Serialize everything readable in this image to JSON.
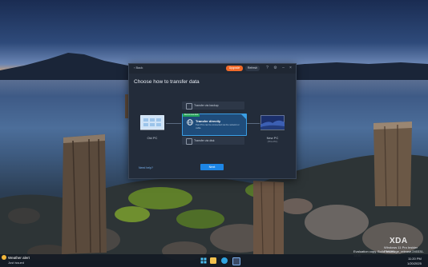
{
  "app": {
    "back_label": "Back",
    "upgrade_label": "Upgrade",
    "refresh_label": "Refresh",
    "heading": "Choose how to transfer data",
    "old_pc_label": "Old PC",
    "new_pc_label": "New PC",
    "new_pc_sublabel": "(This PC)",
    "options": [
      {
        "label": "Transfer via backup",
        "selected": false
      },
      {
        "label": "Transfer directly",
        "selected": true,
        "badge": "Recommended",
        "description": "Two PCs can be connected via the network or cable."
      },
      {
        "label": "Transfer via disk",
        "selected": false
      }
    ],
    "help_link": "Need help?",
    "next_label": "Next",
    "colors": {
      "accent": "#1d86e6",
      "upgrade": "#f06a2a",
      "recommended": "#23a35a"
    }
  },
  "taskbar": {
    "weather_title": "Weather alert",
    "weather_sub": "Just issued",
    "time": "11:20 PM",
    "date": "1/20/2025",
    "icons": [
      "start-icon",
      "search-icon",
      "file-explorer-icon",
      "edge-icon",
      "app-icon"
    ]
  },
  "watermark": {
    "line1": "Windows 11 Pro Insider Preview",
    "line2": "Evaluation copy. Build 26100.ge_release.240331-1435",
    "brand": "XDA"
  }
}
